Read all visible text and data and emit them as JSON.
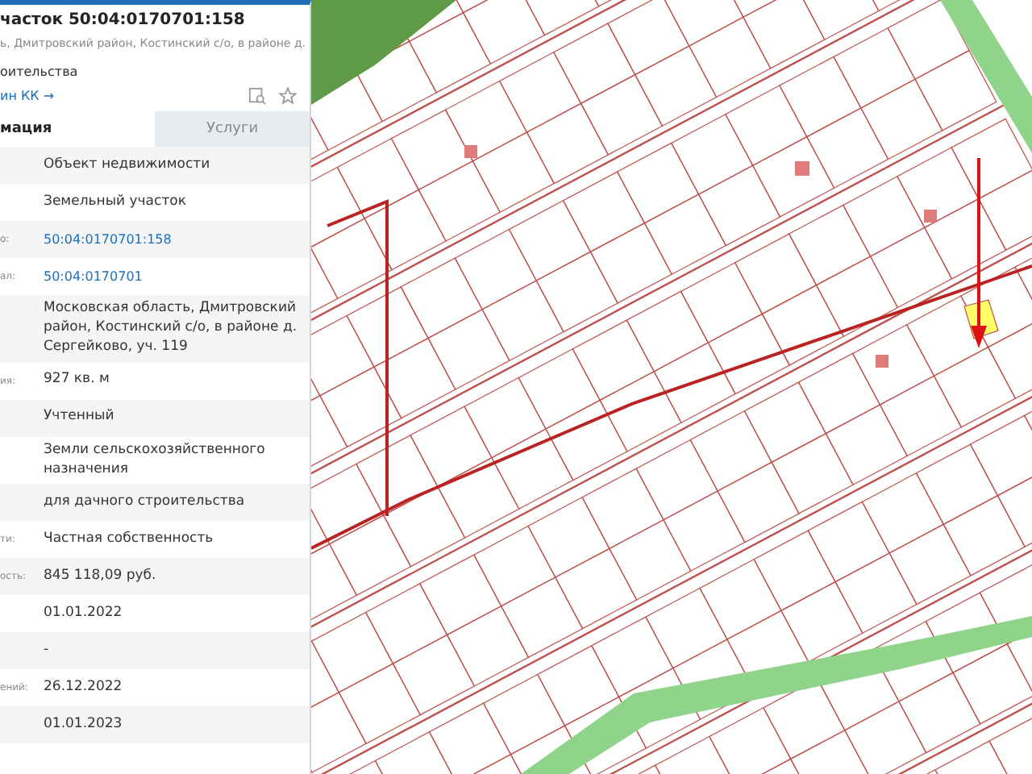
{
  "header": {
    "title": "часток 50:04:0170701:158",
    "subtitle": "ь, Дмитровский район, Костинский с/о, в районе д.",
    "type_line": "оительства",
    "link": "ин КК →"
  },
  "tabs": [
    {
      "label": "мация",
      "selected": true
    },
    {
      "label": "Услуги",
      "selected": false
    }
  ],
  "rows": [
    {
      "label": "",
      "value": "Объект недвижимости",
      "kind": "text"
    },
    {
      "label": "",
      "value": "Земельный участок",
      "kind": "text"
    },
    {
      "label": "о:",
      "value": "50:04:0170701:158",
      "kind": "link"
    },
    {
      "label": "ал:",
      "value": "50:04:0170701",
      "kind": "link"
    },
    {
      "label": "",
      "value": "Московская область, Дмитровский район, Костинский с/о, в районе д. Сергейково, уч. 119",
      "kind": "text"
    },
    {
      "label": "ия:",
      "value": "927 кв. м",
      "kind": "text"
    },
    {
      "label": "",
      "value": "Учтенный",
      "kind": "text"
    },
    {
      "label": "",
      "value": "Земли сельскохозяйственного назначения",
      "kind": "text"
    },
    {
      "label": "",
      "value": "для дачного строительства",
      "kind": "text"
    },
    {
      "label": "ти:",
      "value": "Частная собственность",
      "kind": "text"
    },
    {
      "label": "ость:",
      "value": "845 118,09 руб.",
      "kind": "text"
    },
    {
      "label": "",
      "value": "01.01.2022",
      "kind": "text"
    },
    {
      "label": "",
      "value": "-",
      "kind": "text"
    },
    {
      "label": "ений:",
      "value": "26.12.2022",
      "kind": "text"
    },
    {
      "label": "",
      "value": "01.01.2023",
      "kind": "text"
    }
  ]
}
